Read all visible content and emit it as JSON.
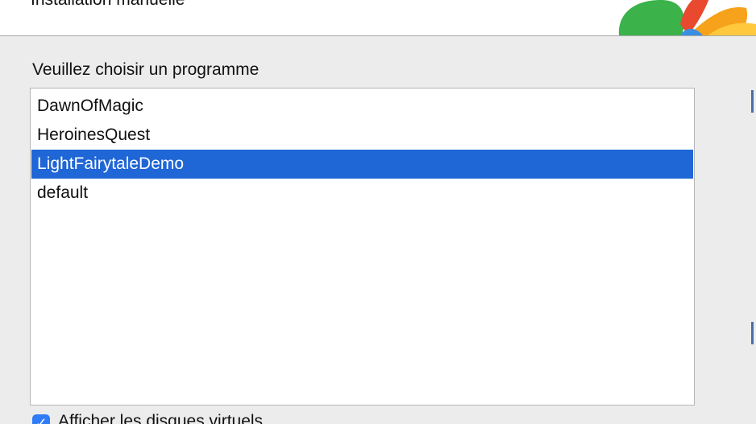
{
  "header": {
    "title": "Installation manuelle",
    "logo_icon": "pinwheel-logo-icon"
  },
  "chooser": {
    "label": "Veuillez choisir un programme",
    "items": [
      {
        "label": "DawnOfMagic",
        "selected": false
      },
      {
        "label": "HeroinesQuest",
        "selected": false
      },
      {
        "label": "LightFairytaleDemo",
        "selected": true
      },
      {
        "label": "default",
        "selected": false
      }
    ]
  },
  "options": {
    "show_virtual_disks_label": "Afficher les disques virtuels",
    "show_virtual_disks_checked": true,
    "checkmark_icon": "checkmark-icon"
  },
  "colors": {
    "selection": "#1f66d6",
    "checkbox": "#2f7cf6",
    "window_bg": "#ececec"
  }
}
